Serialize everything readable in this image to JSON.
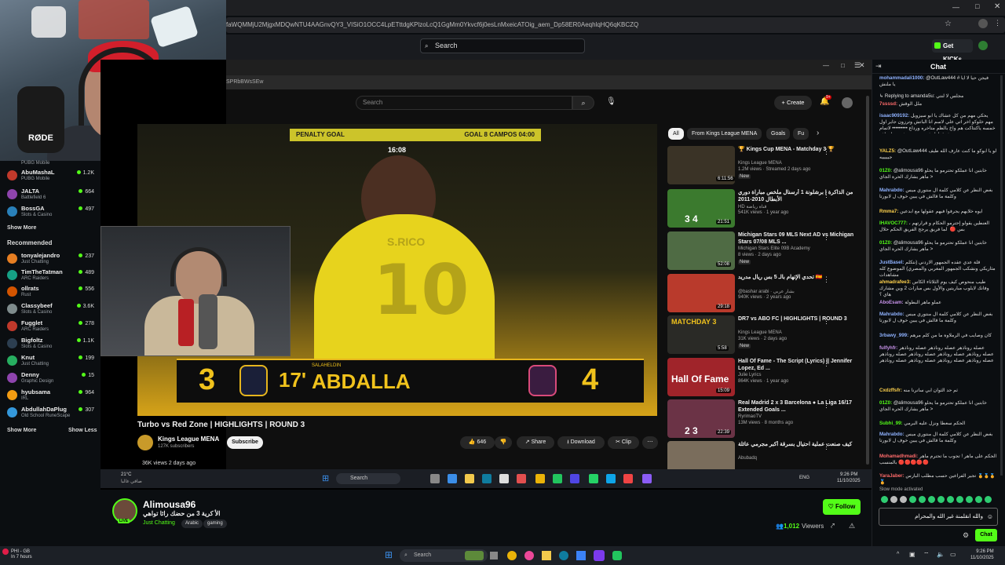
{
  "browser": {
    "url": "faWQMMjU2MjgxMDQwNTU4AAGnvQY3_VISiO1OCC4LpETttdgKPlzoLcQ1GgMm0Ykvcf6j0esLnMxeicATOig_aem_Dp58ER0AeqhlqHQ6qKBCZQ"
  },
  "kick": {
    "search_placeholder": "Search",
    "get_kicks": "Get KICKs"
  },
  "webcam": {
    "mic_brand": "RØDE"
  },
  "sidebar": {
    "top_channels": [
      {
        "name": "",
        "game": "PUBG Mobile",
        "viewers": ""
      },
      {
        "name": "AbuMashaL",
        "game": "PUBG Mobile",
        "viewers": "1.2K"
      },
      {
        "name": "JALTA",
        "game": "Battlefield 6",
        "viewers": "664"
      },
      {
        "name": "BossGA",
        "game": "Slots & Casino",
        "viewers": "497"
      }
    ],
    "show_more": "Show More",
    "recommended_heading": "Recommended",
    "recommended": [
      {
        "name": "tonyalejandro",
        "game": "Just Chatting",
        "viewers": "237"
      },
      {
        "name": "TimTheTatman",
        "game": "ARC Raiders",
        "viewers": "489"
      },
      {
        "name": "ollrats",
        "game": "Rust",
        "viewers": "556"
      },
      {
        "name": "Classybeef",
        "game": "Slots & Casino",
        "viewers": "3.6K"
      },
      {
        "name": "Fugglet",
        "game": "ARC Raiders",
        "viewers": "278"
      },
      {
        "name": "Bigfoltz",
        "game": "Slots & Casino",
        "viewers": "1.1K"
      },
      {
        "name": "Knut",
        "game": "Just Chatting",
        "viewers": "199"
      },
      {
        "name": "Denny",
        "game": "Graphic Design",
        "viewers": "15"
      },
      {
        "name": "hyubsama",
        "game": "IRL",
        "viewers": "964"
      },
      {
        "name": "AbdullahDaPlug",
        "game": "Old School RuneScape",
        "viewers": "307"
      }
    ],
    "show_more_2": "Show More",
    "show_less": "Show Less"
  },
  "youtube": {
    "addr": "SPRbBWsSEw",
    "search_placeholder": "Search",
    "create": "Create",
    "notif_count": "9+",
    "video_title": "Turbo vs Red Zone | HIGHLIGHTS | ROUND 3",
    "channel": "Kings League MENA",
    "subs": "127K subscribers",
    "subscribe": "Subscribe",
    "likes": "646",
    "share": "Share",
    "download": "Download",
    "clip": "Clip",
    "meta": "36K views  2 days ago",
    "banner_left": "PENALTY  GOAL",
    "banner_time": "16:08",
    "banner_right": "GOAL  8 CAMPOS 04:00",
    "score_left": "3",
    "score_right": "4",
    "minute": "17'",
    "scorer_first": "SALAHELDIN",
    "scorer_last": "ABDALLA",
    "jersey_name": "S.RICO",
    "jersey_number": "10",
    "chips": [
      "All",
      "From Kings League MENA",
      "Goals",
      "Fu"
    ],
    "recs": [
      {
        "title": "🏆 Kings Cup MENA - Matchday 3 🏆",
        "channel": "Kings League MENA",
        "stats": "1.2M views · Streamed 2 days ago",
        "badge": "New",
        "dur": "6:11:56",
        "color": "#3a3326"
      },
      {
        "title": "من الذاكرة | برشلونة 1 أرسنال ملخص مباراة دوري الأبطال 2010-2011",
        "channel": "HD قناة رياضة",
        "stats": "541K views · 1 year ago",
        "badge": "",
        "dur": "21:51",
        "color": "#3b7a2e"
      },
      {
        "title": "Michigan Stars 09 MLS Next AD vs Michigan Stars 07/08 MLS ...",
        "channel": "Michigan Stars Elite 09B Academy",
        "stats": "8 views · 2 days ago",
        "badge": "New",
        "dur": "52:08",
        "color": "#4f6b44"
      },
      {
        "title": "تحدي الإتهام بالـ 5 بس ريال مدريد 🇪🇸",
        "channel": "@bashar arabi · بشار عربي",
        "stats": "940K views · 2 years ago",
        "badge": "",
        "dur": "29:18",
        "color": "#b93a2c"
      },
      {
        "title": "DR7 vs ABO FC | HIGHLIGHTS | ROUND 3",
        "channel": "Kings League MENA",
        "stats": "31K views · 2 days ago",
        "badge": "New",
        "dur": "5:58",
        "color": "#2a2a26"
      },
      {
        "title": "Hall Of Fame - The Script (Lyrics) || Jennifer Lopez, Ed ...",
        "channel": "Julie Lyrics",
        "stats": "864K views · 1 year ago",
        "badge": "",
        "dur": "15:09",
        "color": "#a0242a"
      },
      {
        "title": "Real Madrid 2 x 3 Barcelona ● La Liga 16/17 Extended Goals ...",
        "channel": "RyrimaoTV",
        "stats": "13M views · 8 months ago",
        "badge": "",
        "dur": "22:39",
        "color": "#6b3346"
      },
      {
        "title": "كيف صنعت عملية احتيال بسرقة أكبر مجرمي عائلة",
        "channel": "Abubadq",
        "stats": "",
        "badge": "",
        "dur": "",
        "color": "#7a6d5c"
      }
    ],
    "hall_of_fame_thumb": "Hall Of Fame",
    "matchday_thumb": "MATCHDAY 3",
    "thumb_score_1": "3 4",
    "thumb_score_2": "2 3"
  },
  "inner_taskbar": {
    "weather_temp": "21°C",
    "weather_desc": "صافي غالبا",
    "search": "Search",
    "lang": "ENG",
    "time": "9:26 PM",
    "date": "11/10/2025"
  },
  "stream_info": {
    "streamer": "Alimousa96",
    "title": "الأ كرية 3 من حضك رائا تواهي",
    "category": "Just Chatting",
    "tags": [
      "Arabic",
      "gaming"
    ],
    "follow": "Follow",
    "viewers": "1,012",
    "viewers_label": "Viewers",
    "live": "LIVE"
  },
  "chat": {
    "title": "Chat",
    "messages": [
      {
        "user": "mohammadali1000:",
        "text": "@OutLaw444 # فيجن حيا لا ايا",
        "color": "#8fb2ff"
      },
      {
        "user": "",
        "text": "يا ملنش",
        "color": ""
      },
      {
        "user": "",
        "text": "↳ Replying to amanda5u: مجلس لا لنتي",
        "color": ""
      },
      {
        "user": "7ssssd:",
        "text": "ملل الوقش",
        "color": "#ff6b6b"
      },
      {
        "user": "isaac909192:",
        "text": "يحكي مهم من كل عشاك يا ابو سيزويل مهم خلوكو اخر اتي علي لاسم انا الباتش وترزون جاير اول خمسه ياكنتاكت هم واخ بالظم متاخره ورداع ••••••••• لاتمام بفرق اول فريق بيجيب خمس اهداف",
        "color": "#8fb2ff"
      },
      {
        "user": "YALZ5:",
        "text": "@OutLaw444 لو يا ابوكو ما كنت عارف الله طيف جيييييه",
        "color": "#ffd24d"
      },
      {
        "user": "01Z0:",
        "text": "@alimousa96 خابتين انا عملكو تحترمو ما يحلو ماهر يشارك الحرة الجاي >",
        "color": "#53fc18"
      },
      {
        "user": "Mahrabdo:",
        "text": "بغض النظر عن كلامي كلمة ال منتوري ميس وكلمة ما قالش في يبين خوف ل لابورتا",
        "color": "#8fb2ff"
      },
      {
        "user": "Rmma7:",
        "text": "ايوه خلايهم يجرفوا فيهم عقولها مع ابدعين",
        "color": "#ffd24d"
      },
      {
        "user": "IHAVOC777:",
        "text": "العنطين يقولو إحترمو الحكام و قرارتهم ، بس 🔴 ‏ لما فريق يرجح الفريق الحكم حلال",
        "color": "#53fc18"
      },
      {
        "user": "01Z0:",
        "text": "@alimousa96 خابتين انا عملكو تحترمو ما يحلو ماهر يشارك الحرة الجاي >",
        "color": "#53fc18"
      },
      {
        "user": "JustBasel:",
        "text": "قلة عدي عقده الجمهور الاردني (نتكلم مثاريكي ونشكب الجمهور المغربي والمصري) الموضوع كله مشاهدات",
        "color": "#8fb2ff"
      },
      {
        "user": "ahmadrafee3:",
        "text": "طيب منحوص كيف يوم الثلاثاء الكأس وفانك لايلوب مباريتين والأول بس مبارات 2 وين مشارك هاي ؟",
        "color": "#ffd24d"
      },
      {
        "user": "AboEsam:",
        "text": "عملو ماهر البطولة",
        "color": "#c792ea"
      },
      {
        "user": "Mahrabdo:",
        "text": "بغض النظر عن كلامي كلمة ال منتوري ميس وكلمة ما قالش في يبين خوف ل لابورتا",
        "color": "#8fb2ff"
      },
      {
        "user": "3rbawy_999:",
        "text": "كان وصايب في الرملاوة ما من كلم مرهم",
        "color": "#8fb2ff"
      },
      {
        "user": "fulfyhfr:",
        "text": "عصله روناذهر عصله روناذهر عصله روناذهر عصله روناذهر عصله روناذهر عصله روناذهر عصله روناذهر عصله روناذهر عصله روناذهر عصله روناذهر عصله روناذهر",
        "color": "#c792ea"
      },
      {
        "user": "Cxdzffsfr:",
        "text": "ثم حد الثوان ابي ساترنا منه",
        "color": "#ffd24d"
      },
      {
        "user": "01Z0:",
        "text": "@alimousa96 خابتين انا عملكو تحترمو ما يحلو ماهر يشارك الحرة الجاي >",
        "color": "#53fc18"
      },
      {
        "user": "Subhi_99:",
        "text": "الحكم سعطا ونزل عليه البرمي",
        "color": "#53fc18"
      },
      {
        "user": "Mahrabdo:",
        "text": "بغض النظر عن كلامي كلمة ال منتوري ميس وكلمة ما قالش في يبين خوف ل لابورتا",
        "color": "#8fb2ff"
      },
      {
        "user": "Mohamadhmadi:",
        "text": "الحكم على ماهر ! تجوب ما تحترم ماهر بالمنسب 🔴🔴🔴🔴🔴",
        "color": "#ff6b6b"
      },
      {
        "user": "YaraJaber:",
        "text": "تجير الفراعين حسب مطلب البارس 🏅🏅🏅🏅",
        "color": "#ff6b6b"
      }
    ],
    "slow_mode": "Slow mode activated",
    "input_text": "والله انقلمنة غير الله والمحرام",
    "chat_button": "Chat"
  },
  "taskbar": {
    "weather_name": "PHI - GB",
    "weather_desc": "In 7 hours",
    "search": "Search",
    "time": "9:26 PM",
    "date": "11/10/2025"
  }
}
